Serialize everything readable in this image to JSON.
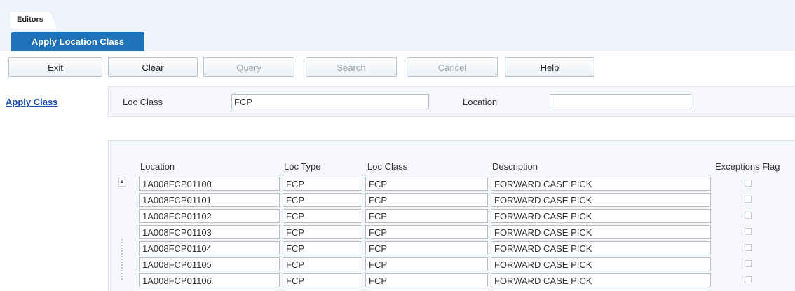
{
  "header": {
    "tab_label": "Editors",
    "screen_title": "Apply Location Class"
  },
  "toolbar": {
    "exit": "Exit",
    "clear": "Clear",
    "query": "Query",
    "search": "Search",
    "cancel": "Cancel",
    "help": "Help"
  },
  "sidebar": {
    "apply_class_link": "Apply Class"
  },
  "form": {
    "loc_class_label": "Loc Class",
    "loc_class_value": "FCP",
    "location_label": "Location",
    "location_value": ""
  },
  "table": {
    "columns": [
      "Location",
      "Loc Type",
      "Loc Class",
      "Description",
      "Exceptions Flag"
    ],
    "rows": [
      {
        "location": "1A008FCP01100",
        "loc_type": "FCP",
        "loc_class": "FCP",
        "description": "FORWARD CASE PICK",
        "exceptions_flag": false
      },
      {
        "location": "1A008FCP01101",
        "loc_type": "FCP",
        "loc_class": "FCP",
        "description": "FORWARD CASE PICK",
        "exceptions_flag": false
      },
      {
        "location": "1A008FCP01102",
        "loc_type": "FCP",
        "loc_class": "FCP",
        "description": "FORWARD CASE PICK",
        "exceptions_flag": false
      },
      {
        "location": "1A008FCP01103",
        "loc_type": "FCP",
        "loc_class": "FCP",
        "description": "FORWARD CASE PICK",
        "exceptions_flag": false
      },
      {
        "location": "1A008FCP01104",
        "loc_type": "FCP",
        "loc_class": "FCP",
        "description": "FORWARD CASE PICK",
        "exceptions_flag": false
      },
      {
        "location": "1A008FCP01105",
        "loc_type": "FCP",
        "loc_class": "FCP",
        "description": "FORWARD CASE PICK",
        "exceptions_flag": false
      },
      {
        "location": "1A008FCP01106",
        "loc_type": "FCP",
        "loc_class": "FCP",
        "description": "FORWARD CASE PICK",
        "exceptions_flag": false
      }
    ]
  },
  "icons": {
    "scroll_up": "scroll-up-arrow-icon",
    "scroll_grip": "scroll-grip-icon"
  },
  "colors": {
    "accent": "#1e73b8",
    "link": "#1a4fb3",
    "panel": "#f5f7fa"
  }
}
